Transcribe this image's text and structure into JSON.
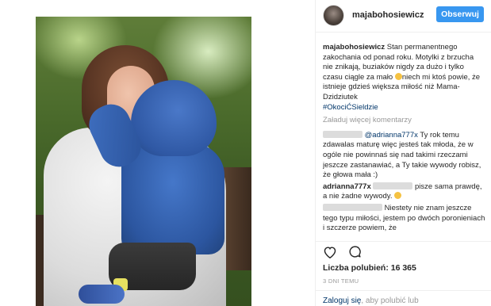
{
  "post": {
    "username": "majabohosiewicz",
    "follow_label": "Obserwuj",
    "caption_user": "majabohosiewicz",
    "caption_text": "Stan permanentnego zakochania od ponad roku. Motylki z brzucha nie znikają, buziaków nigdy za dużo i tylko czasu ciągle za mało",
    "caption_text_2": "niech mi ktoś powie, że istnieje gdzieś większa miłość niż Mama-Dzidziutek",
    "hashtag": "#OkociĆSieldzie",
    "load_more": "Załaduj więcej komentarzy"
  },
  "comments": [
    {
      "mention": "@adrianna777x",
      "text": "Ty rok temu zdawalas maturę więc jesteś tak młoda, że w ogóle nie powinnaś się nad takimi rzeczami jeszcze zastanawiać, a Ty takie wywody robisz, że głowa mała :)"
    },
    {
      "user": "adrianna777x",
      "text": "pisze sama prawdę, a nie żadne wywody."
    },
    {
      "text": "Niestety nie znam jeszcze tego typu miłości, jestem po dwóch poronieniach i szczerze powiem, że"
    }
  ],
  "footer": {
    "likes": "Liczba polubień: 16 365",
    "time": "3 DNI TEMU",
    "login_link": "Zaloguj się",
    "login_rest": ", aby polubić lub"
  },
  "icons": [
    "heart-icon",
    "comment-icon"
  ],
  "colors": {
    "accent": "#3897f0",
    "link": "#003569",
    "muted": "#999999"
  }
}
